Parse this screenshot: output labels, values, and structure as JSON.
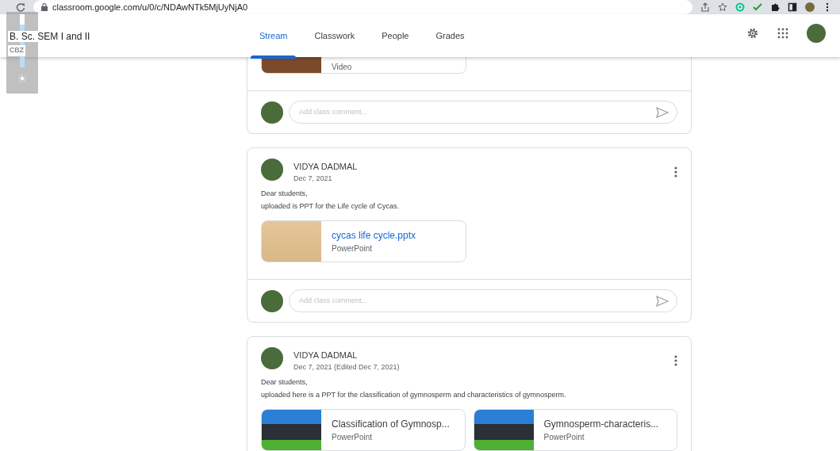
{
  "browser": {
    "url": "classroom.google.com/u/0/c/NDAwNTk5MjUyNjA0"
  },
  "class_info": {
    "title": "B. Sc. SEM I and II",
    "section": "CBZ"
  },
  "brightness_overlay": {
    "level": 0.8
  },
  "tabs": [
    {
      "label": "Stream",
      "selected": true
    },
    {
      "label": "Classwork",
      "selected": false
    },
    {
      "label": "People",
      "selected": false
    },
    {
      "label": "Grades",
      "selected": false
    }
  ],
  "posts": [
    {
      "attachments": [
        {
          "type": "Video",
          "kind": "video"
        }
      ],
      "comment_placeholder": "Add class comment..."
    },
    {
      "author": "VIDYA DADMAL",
      "date": "Dec 7, 2021",
      "body": [
        "Dear students,",
        "uploaded is PPT for the Life cycle of Cycas."
      ],
      "attachments": [
        {
          "title": "cycas life cycle.pptx",
          "link": true,
          "type": "PowerPoint",
          "kind": "plain"
        }
      ],
      "comment_placeholder": "Add class comment..."
    },
    {
      "author": "VIDYA DADMAL",
      "date": "Dec 7, 2021 (Edited Dec 7, 2021)",
      "body": [
        "Dear students,",
        "uploaded here is a PPT for the classification of gymnosperm and characteristics of gymnosperm."
      ],
      "attachments": [
        {
          "title": "Classification of Gymnosp...",
          "link": false,
          "type": "PowerPoint",
          "kind": "slide"
        },
        {
          "title": "Gymnosperm-characteris...",
          "link": false,
          "type": "PowerPoint",
          "kind": "slide"
        }
      ]
    }
  ]
}
